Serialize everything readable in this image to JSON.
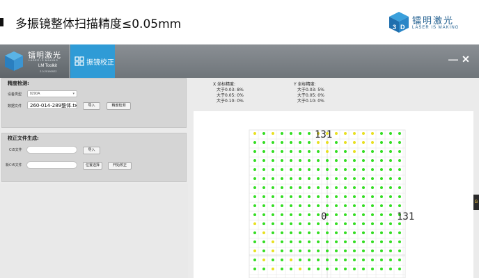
{
  "slide": {
    "title": "多振镜整体扫描精度≤0.05mm",
    "logo": {
      "name_cn": "镭明激光",
      "name_en": "LASER IS MAKING"
    }
  },
  "app": {
    "logo": {
      "name_cn": "镭明激光",
      "name_en": "LASER IS MAKING",
      "toolkit": "LM Toolkit",
      "version": "2.0.20180922"
    },
    "active_tab": "振镜校正",
    "window_controls": {
      "minimize": "—",
      "close": "✕"
    }
  },
  "precision_panel": {
    "title": "精度检测:",
    "device_label": "设备类型",
    "device_value": "8290A",
    "file_label": "数据文件",
    "file_value": "260-014-289整体.txt",
    "import_button": "导入",
    "check_button": "精度检测"
  },
  "correction_panel": {
    "title": "校正文件生成:",
    "ct5_label": "Ct5文件",
    "import_button": "导入",
    "new_ct5_label": "新Ct5文件",
    "location_button": "位置选择",
    "start_button": "开始校正"
  },
  "stats": {
    "x": {
      "header": "X 坐标精度:",
      "rows": [
        "大于0.03: 8%",
        "大于0.05: 0%",
        "大于0.10: 0%"
      ]
    },
    "y": {
      "header": "Y 坐标精度:",
      "rows": [
        "大于0.03: 5%",
        "大于0.05: 0%",
        "大于0.10: 0%"
      ]
    }
  },
  "chart_data": {
    "type": "scatter",
    "labels": {
      "top": "131",
      "center": "0",
      "right": "131"
    },
    "grid": {
      "columns": 17,
      "rows": 18
    },
    "colors": {
      "ok": "#33dd22",
      "warn": "#e8e020",
      "grid": "#e6e6e6",
      "axis": "#dcdcdc"
    },
    "yellow_points": [
      [
        0,
        0
      ],
      [
        2,
        0
      ],
      [
        7,
        0
      ],
      [
        8,
        0
      ],
      [
        9,
        0
      ],
      [
        10,
        0
      ],
      [
        11,
        0
      ],
      [
        12,
        0
      ],
      [
        13,
        0
      ],
      [
        7,
        1
      ],
      [
        8,
        1
      ],
      [
        10,
        1
      ],
      [
        11,
        1
      ],
      [
        12,
        1
      ],
      [
        13,
        1
      ],
      [
        8,
        2
      ],
      [
        11,
        2
      ],
      [
        0,
        10
      ],
      [
        1,
        11
      ],
      [
        2,
        12
      ],
      [
        0,
        13
      ],
      [
        2,
        13
      ],
      [
        1,
        14
      ],
      [
        4,
        14
      ],
      [
        2,
        15
      ],
      [
        5,
        15
      ],
      [
        2,
        16
      ],
      [
        4,
        16
      ],
      [
        5,
        16
      ],
      [
        1,
        17
      ],
      [
        3,
        17
      ],
      [
        4,
        17
      ],
      [
        5,
        17
      ]
    ]
  },
  "side_tab": {
    "label": "G"
  }
}
